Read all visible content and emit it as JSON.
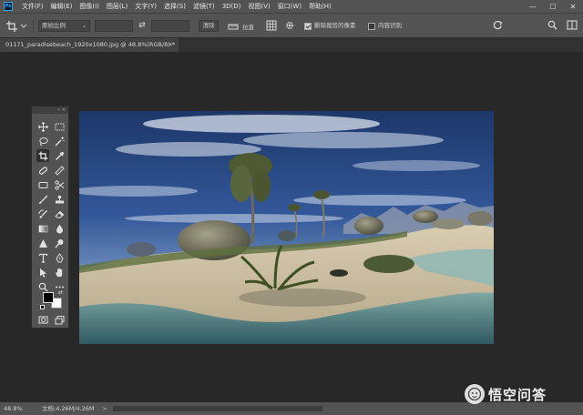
{
  "menubar": {
    "app_logo": "Ps",
    "items": [
      "文件(F)",
      "编辑(E)",
      "图像(I)",
      "图层(L)",
      "文字(Y)",
      "选择(S)",
      "滤镜(T)",
      "3D(D)",
      "视图(V)",
      "窗口(W)",
      "帮助(H)"
    ],
    "window_controls": [
      "—",
      "☐",
      "✕"
    ]
  },
  "options": {
    "ratio_preset": "原始比例",
    "swap_symbol": "⇄",
    "clear_label": "清除",
    "straighten_label": "拉直",
    "delete_cropped_label": "删除裁剪的像素",
    "delete_cropped_checked": true,
    "content_aware_label": "内容识别",
    "content_aware_checked": false
  },
  "document": {
    "tab_title": "01171_paradisebeach_1920x1080.jpg @ 48.8%(RGB/8) *",
    "close_symbol": "×"
  },
  "toolbox": {
    "header": "«  ×",
    "tools": [
      "move-tool",
      "marquee-tool",
      "lasso-tool",
      "magic-wand-tool",
      "crop-tool",
      "eyedropper-tool",
      "healing-brush-tool",
      "ruler-tool",
      "frame-tool",
      "scissors-tool",
      "brush-tool",
      "stamp-tool",
      "history-brush-tool",
      "eraser-tool",
      "gradient-tool",
      "blur-tool",
      "sharpen-tool",
      "dodge-tool",
      "type-tool",
      "pen-tool",
      "path-selection-tool",
      "hand-tool",
      "zoom-tool",
      "more-tools"
    ],
    "active_tool": "crop-tool",
    "foreground_color": "#000000",
    "background_color": "#ffffff"
  },
  "status": {
    "zoom": "48.8%",
    "doc_info": "文档:4.26M/4.26M",
    "arrow": ">"
  },
  "watermark": {
    "text": "悟空问答"
  }
}
